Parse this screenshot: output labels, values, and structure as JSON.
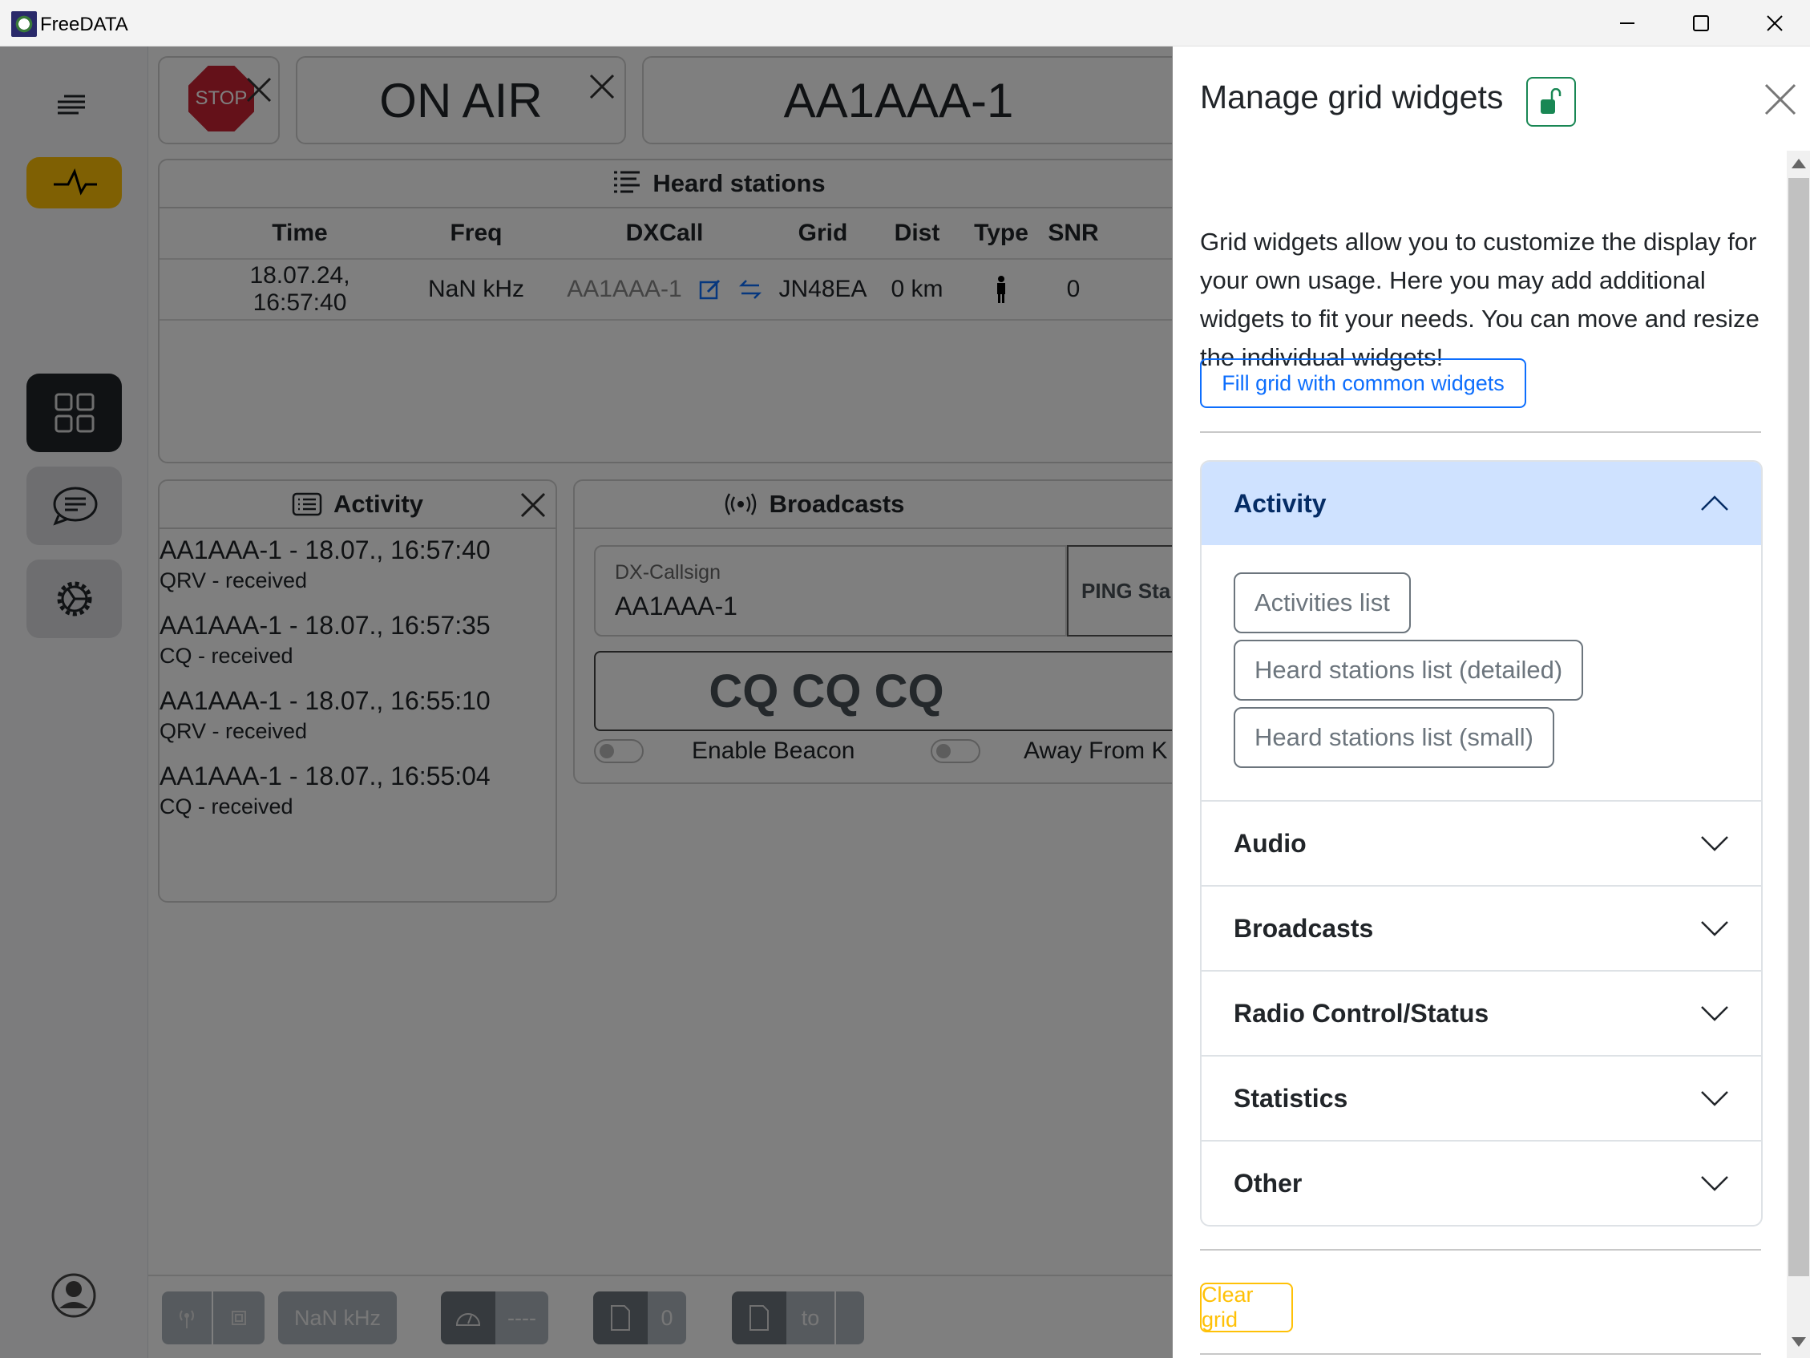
{
  "window": {
    "title": "FreeDATA",
    "controls": [
      "minimize",
      "maximize",
      "close"
    ]
  },
  "nav": {
    "items": [
      {
        "name": "menu",
        "icon": "menu-icon"
      },
      {
        "name": "status",
        "icon": "activity-pulse-icon",
        "color": "#ffc107"
      },
      {
        "name": "grid",
        "icon": "grid-icon",
        "active": true
      },
      {
        "name": "chat",
        "icon": "chat-icon"
      },
      {
        "name": "settings",
        "icon": "gear-icon"
      },
      {
        "name": "profile",
        "icon": "person-circle-icon"
      }
    ]
  },
  "top_widgets": {
    "stop_label": "STOP",
    "on_air": "ON AIR",
    "callsign": "AA1AAA-1"
  },
  "heard_stations": {
    "title": "Heard stations",
    "columns": [
      "Time",
      "Freq",
      "DXCall",
      "Grid",
      "Dist",
      "Type",
      "SNR"
    ],
    "rows": [
      {
        "time": "18.07.24, 16:57:40",
        "freq": "NaN kHz",
        "dxcall": "AA1AAA-1",
        "grid": "JN48EA",
        "dist": "0 km",
        "type": "person-icon",
        "snr": "0"
      }
    ]
  },
  "activity": {
    "title": "Activity",
    "items": [
      {
        "header": "AA1AAA-1 - 18.07., 16:57:40",
        "detail": "QRV - received"
      },
      {
        "header": "AA1AAA-1 - 18.07., 16:57:35",
        "detail": "CQ - received"
      },
      {
        "header": "AA1AAA-1 - 18.07., 16:55:10",
        "detail": "QRV - received"
      },
      {
        "header": "AA1AAA-1 - 18.07., 16:55:04",
        "detail": "CQ - received"
      }
    ]
  },
  "broadcasts": {
    "title": "Broadcasts",
    "dx_label": "DX-Callsign",
    "dx_value": "AA1AAA-1",
    "ping_label": "PING Sta",
    "cq_label": "CQ CQ CQ",
    "beacon_label": "Enable Beacon",
    "away_label": "Away From K"
  },
  "bottom_bar": {
    "freq": "NaN kHz",
    "speed": "----",
    "bytes": "0",
    "to": "to"
  },
  "drawer": {
    "title": "Manage grid widgets",
    "description": "Grid widgets allow you to customize the display for your own usage. Here you may add additional widgets to fit your needs. You can move and resize the individual widgets!",
    "fill_button": "Fill grid with common widgets",
    "clear_button": "Clear grid",
    "sections": [
      {
        "label": "Activity",
        "open": true,
        "widgets": [
          "Activities list",
          "Heard stations list (detailed)",
          "Heard stations list (small)"
        ]
      },
      {
        "label": "Audio",
        "open": false
      },
      {
        "label": "Broadcasts",
        "open": false
      },
      {
        "label": "Radio Control/Status",
        "open": false
      },
      {
        "label": "Statistics",
        "open": false
      },
      {
        "label": "Other",
        "open": false
      }
    ],
    "colors": {
      "primary": "#0d6efd",
      "warning": "#ffc107",
      "success": "#198754",
      "accordion_active": "#cfe2ff"
    }
  }
}
